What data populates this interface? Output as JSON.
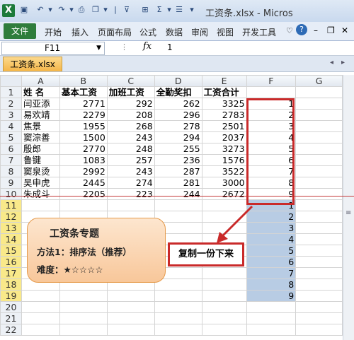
{
  "titlebar": {
    "app_icon": "excel-logo-icon",
    "title": "工资条.xlsx - Micros"
  },
  "ribbon": {
    "file_tab": "文件",
    "tabs": [
      "开始",
      "插入",
      "页面布局",
      "公式",
      "数据",
      "审阅",
      "视图",
      "开发工具"
    ]
  },
  "formula_bar": {
    "name_box": "F11",
    "fx": "fx",
    "value": "1"
  },
  "workbook_tab": "工资条.xlsx",
  "grid": {
    "col_headers": [
      "A",
      "B",
      "C",
      "D",
      "E",
      "F",
      "G"
    ],
    "rows": [
      {
        "n": "1",
        "cells": [
          "姓 名",
          "基本工资",
          "加班工资",
          "全勤奖扣",
          "工资合计",
          "",
          ""
        ]
      },
      {
        "n": "2",
        "cells": [
          "闫亚添",
          "2771",
          "292",
          "262",
          "3325",
          "1",
          ""
        ]
      },
      {
        "n": "3",
        "cells": [
          "易欢靖",
          "2279",
          "208",
          "296",
          "2783",
          "2",
          ""
        ]
      },
      {
        "n": "4",
        "cells": [
          "焦景",
          "1955",
          "268",
          "278",
          "2501",
          "3",
          ""
        ]
      },
      {
        "n": "5",
        "cells": [
          "窦淙善",
          "1500",
          "243",
          "294",
          "2037",
          "4",
          ""
        ]
      },
      {
        "n": "6",
        "cells": [
          "殷郎",
          "2770",
          "248",
          "255",
          "3273",
          "5",
          ""
        ]
      },
      {
        "n": "7",
        "cells": [
          "鲁键",
          "1083",
          "257",
          "236",
          "1576",
          "6",
          ""
        ]
      },
      {
        "n": "8",
        "cells": [
          "窦泉烫",
          "2992",
          "243",
          "287",
          "3522",
          "7",
          ""
        ]
      },
      {
        "n": "9",
        "cells": [
          "吴申虎",
          "2445",
          "274",
          "281",
          "3000",
          "8",
          ""
        ]
      },
      {
        "n": "10",
        "cells": [
          "朱成斗",
          "2205",
          "223",
          "244",
          "2672",
          "9",
          ""
        ]
      },
      {
        "n": "11",
        "cells": [
          "",
          "",
          "",
          "",
          "",
          "1",
          ""
        ]
      },
      {
        "n": "12",
        "cells": [
          "",
          "",
          "",
          "",
          "",
          "2",
          ""
        ]
      },
      {
        "n": "13",
        "cells": [
          "",
          "",
          "",
          "",
          "",
          "3",
          ""
        ]
      },
      {
        "n": "14",
        "cells": [
          "",
          "",
          "",
          "",
          "",
          "4",
          ""
        ]
      },
      {
        "n": "15",
        "cells": [
          "",
          "",
          "",
          "",
          "",
          "5",
          ""
        ]
      },
      {
        "n": "16",
        "cells": [
          "",
          "",
          "",
          "",
          "",
          "6",
          ""
        ]
      },
      {
        "n": "17",
        "cells": [
          "",
          "",
          "",
          "",
          "",
          "7",
          ""
        ]
      },
      {
        "n": "18",
        "cells": [
          "",
          "",
          "",
          "",
          "",
          "8",
          ""
        ]
      },
      {
        "n": "19",
        "cells": [
          "",
          "",
          "",
          "",
          "",
          "9",
          ""
        ]
      },
      {
        "n": "20",
        "cells": [
          "",
          "",
          "",
          "",
          "",
          "",
          ""
        ]
      },
      {
        "n": "21",
        "cells": [
          "",
          "",
          "",
          "",
          "",
          "",
          ""
        ]
      },
      {
        "n": "22",
        "cells": [
          "",
          "",
          "",
          "",
          "",
          "",
          ""
        ]
      }
    ]
  },
  "annotation": {
    "panel_title": "工资条专题",
    "method": "方法1：排序法（推荐）",
    "difficulty": "难度：★☆☆☆☆",
    "callout": "复制一份下来",
    "accent_red": "#c92a2a"
  }
}
